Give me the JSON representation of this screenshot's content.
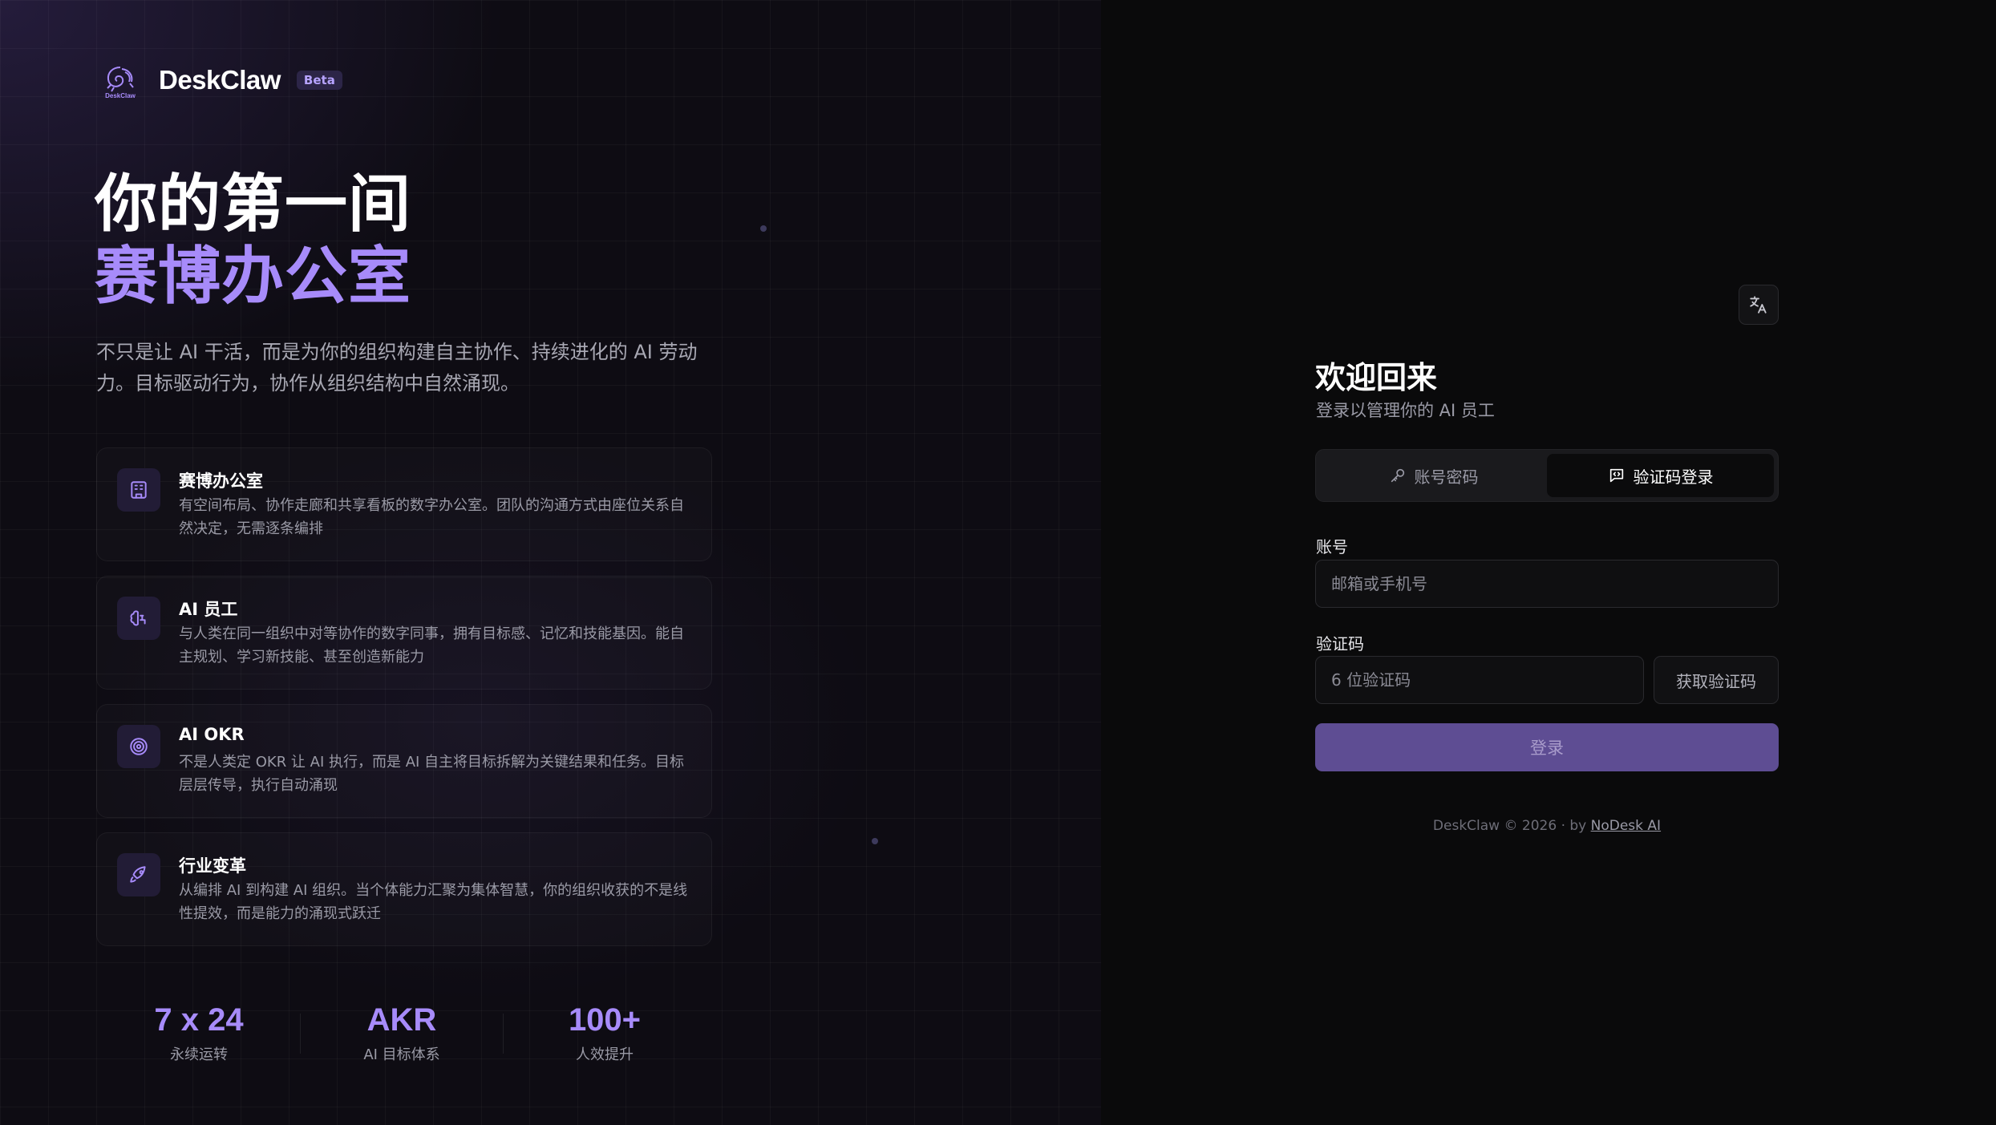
{
  "brand": {
    "name": "DeskClaw",
    "badge": "Beta",
    "logo_text": "DeskClaw"
  },
  "hero": {
    "line1": "你的第一间",
    "line2": "赛博办公室",
    "description": "不只是让 AI 干活，而是为你的组织构建自主协作、持续进化的 AI 劳动力。目标驱动行为，协作从组织结构中自然涌现。"
  },
  "features": [
    {
      "icon": "building-icon",
      "title": "赛博办公室",
      "desc": "有空间布局、协作走廊和共享看板的数字办公室。团队的沟通方式由座位关系自然决定，无需逐条编排"
    },
    {
      "icon": "brain-icon",
      "title": "AI 员工",
      "desc": "与人类在同一组织中对等协作的数字同事，拥有目标感、记忆和技能基因。能自主规划、学习新技能、甚至创造新能力"
    },
    {
      "icon": "target-icon",
      "title": "AI OKR",
      "desc": "不是人类定 OKR 让 AI 执行，而是 AI 自主将目标拆解为关键结果和任务。目标层层传导，执行自动涌现"
    },
    {
      "icon": "rocket-icon",
      "title": "行业变革",
      "desc": "从编排 AI 到构建 AI 组织。当个体能力汇聚为集体智慧，你的组织收获的不是线性提效，而是能力的涌现式跃迁"
    }
  ],
  "stats": [
    {
      "value": "7 x 24",
      "label": "永续运转"
    },
    {
      "value": "AKR",
      "label": "AI 目标体系"
    },
    {
      "value": "100+",
      "label": "人效提升"
    }
  ],
  "login": {
    "language_icon": "translate-icon",
    "title": "欢迎回来",
    "subtitle": "登录以管理你的 AI 员工",
    "tabs": [
      {
        "label": "账号密码",
        "icon": "key-icon",
        "active": false
      },
      {
        "label": "验证码登录",
        "icon": "message-code-icon",
        "active": true
      }
    ],
    "account_label": "账号",
    "account_placeholder": "邮箱或手机号",
    "code_label": "验证码",
    "code_placeholder": "6 位验证码",
    "get_code_label": "获取验证码",
    "submit_label": "登录",
    "footer_text": "DeskClaw © 2026 · by ",
    "footer_link": "NoDesk AI"
  },
  "colors": {
    "accent": "#a78bfa",
    "button": "#5e4d93",
    "background": "#0a0a0b"
  }
}
